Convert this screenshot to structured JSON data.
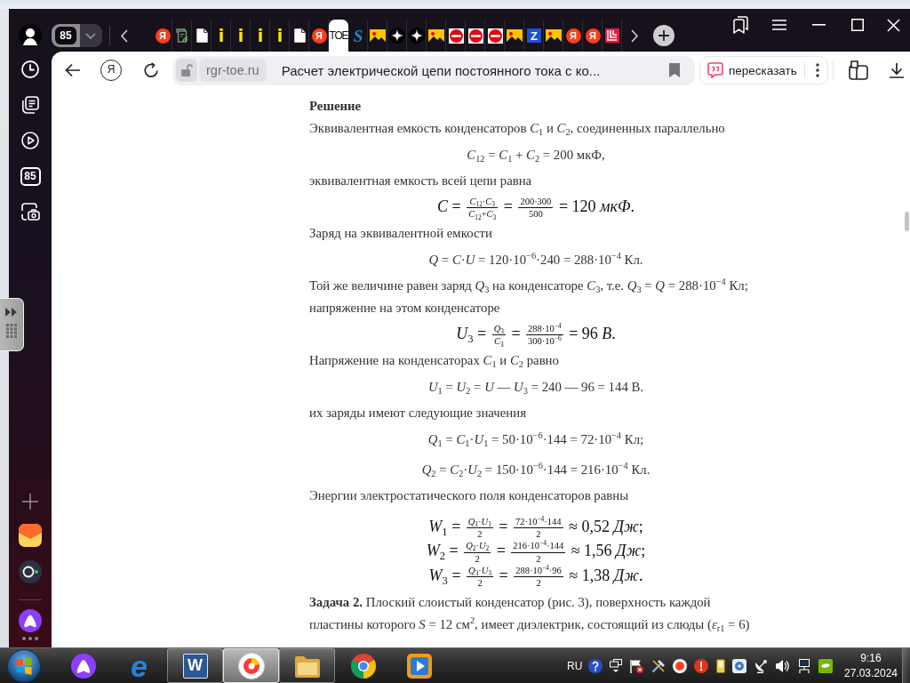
{
  "browser": {
    "tab_counter": "85",
    "tabs": [
      {
        "kind": "yandex",
        "glyph": "Я",
        "selected": false
      },
      {
        "kind": "sheet",
        "selected": false
      },
      {
        "kind": "page",
        "selected": false
      },
      {
        "kind": "info",
        "glyph": "i",
        "selected": false
      },
      {
        "kind": "info",
        "glyph": "i",
        "selected": false
      },
      {
        "kind": "info",
        "glyph": "i",
        "selected": false
      },
      {
        "kind": "info",
        "glyph": "i",
        "selected": false
      },
      {
        "kind": "page",
        "selected": false
      },
      {
        "kind": "yandex",
        "glyph": "Я",
        "selected": false
      },
      {
        "kind": "toe",
        "glyph": "TOE",
        "selected": true
      },
      {
        "kind": "letter",
        "glyph": "S",
        "selected": false
      },
      {
        "kind": "image",
        "selected": false
      },
      {
        "kind": "star",
        "selected": false
      },
      {
        "kind": "star",
        "selected": false
      },
      {
        "kind": "image",
        "selected": false
      },
      {
        "kind": "mon",
        "selected": false
      },
      {
        "kind": "mon",
        "selected": false
      },
      {
        "kind": "mon",
        "selected": false
      },
      {
        "kind": "image",
        "selected": false
      },
      {
        "kind": "square-letter",
        "glyph": "Z",
        "selected": false
      },
      {
        "kind": "image",
        "selected": false
      },
      {
        "kind": "yandex",
        "glyph": "Я",
        "selected": false
      },
      {
        "kind": "yandex",
        "glyph": "Я",
        "selected": false
      },
      {
        "kind": "stripes",
        "selected": false
      }
    ]
  },
  "address_bar": {
    "home_glyph": "Я",
    "domain": "rgr-toe.ru",
    "page_title": "Расчет электрической цепи постоянного тока с ко...",
    "retell_button": "пересказать"
  },
  "sidebar": {
    "counter": "85"
  },
  "article": {
    "blocks": [
      {
        "kind": "heading",
        "text": "Решение"
      },
      {
        "kind": "text",
        "text": "Эквивалентная емкость конденсаторов *C*$_{1}$ и *C*$_{2}$, соединенных параллельно"
      },
      {
        "kind": "formula",
        "text": "*C*$_{12}$ = *C*$_{1}$ + *C*$_{2}$ = 200 мкФ,"
      },
      {
        "kind": "text",
        "text": "эквивалентная емкость всей цепи равна"
      },
      {
        "kind": "display",
        "rows": [
          {
            "parts": [
              {
                "kind": "text",
                "text": "*C* = "
              },
              {
                "kind": "fraction",
                "numerator": "*C*$_{12}$·*C*$_{3}$",
                "denominator": "*C*$_{12}$+*C*$_{3}$"
              },
              {
                "kind": "text",
                "text": " = "
              },
              {
                "kind": "fraction",
                "numerator": "200·300",
                "denominator": "500"
              },
              {
                "kind": "text",
                "text": " = 120 *мкФ*."
              }
            ]
          }
        ]
      },
      {
        "kind": "text",
        "text": "Заряд на эквивалентной емкости"
      },
      {
        "kind": "formula",
        "text": "*Q* = *C*·*U* = 120·10$^{−6}$·240 = 288·10$^{−4}$ Кл."
      },
      {
        "kind": "text",
        "text": "Той же величине равен заряд *Q*$_{3}$ на конденсаторе *C*$_{3}$, т.е. *Q*$_{3}$ = *Q* = 288·10$^{−4}$ Кл;\nнапряжение на этом конденсаторе"
      },
      {
        "kind": "display",
        "rows": [
          {
            "parts": [
              {
                "kind": "text",
                "text": "*U*$_{3}$ = "
              },
              {
                "kind": "fraction",
                "numerator": "*Q*$_{3}$",
                "denominator": "*C*$_{3}$"
              },
              {
                "kind": "text",
                "text": " = "
              },
              {
                "kind": "fraction",
                "numerator": "288·10$^{−4}$",
                "denominator": "300·10$^{−6}$"
              },
              {
                "kind": "text",
                "text": " = 96 *В*."
              }
            ]
          }
        ]
      },
      {
        "kind": "text",
        "text": "Напряжение на конденсаторах *C*$_{1}$ и *C*$_{2}$ равно"
      },
      {
        "kind": "formula",
        "text": "*U*$_{1}$ = *U*$_{2}$ = *U* — *U*$_{3}$ = 240 — 96 = 144 В."
      },
      {
        "kind": "text",
        "text": "их заряды имеют следующие значения"
      },
      {
        "kind": "formula",
        "text": "*Q*$_{1}$ = *C*$_{1}$·*U*$_{1}$ = 50·10$^{−6}$·144 = 72·10$^{−4}$ Кл;"
      },
      {
        "kind": "formula",
        "text": "*Q*$_{2}$ = *C*$_{2}$·*U*$_{2}$ = 150·10$^{−6}$·144 = 216·10$^{−4}$ Кл."
      },
      {
        "kind": "text",
        "text": "Энергии электростатического поля конденсаторов равны"
      },
      {
        "kind": "display",
        "rows": [
          {
            "parts": [
              {
                "kind": "text",
                "text": "*W*$_{1}$ = "
              },
              {
                "kind": "fraction",
                "numerator": "*Q*$_{1}$·*U*$_{1}$",
                "denominator": "2"
              },
              {
                "kind": "text",
                "text": " = "
              },
              {
                "kind": "fraction",
                "numerator": "72·10$^{−4}$·144",
                "denominator": "2"
              },
              {
                "kind": "text",
                "text": " ≈ 0,52 *Дж*;"
              }
            ]
          },
          {
            "parts": [
              {
                "kind": "text",
                "text": "*W*$_{2}$ = "
              },
              {
                "kind": "fraction",
                "numerator": "*Q*$_{2}$·*U*$_{2}$",
                "denominator": "2"
              },
              {
                "kind": "text",
                "text": " = "
              },
              {
                "kind": "fraction",
                "numerator": "216·10$^{−4}$·144",
                "denominator": "2"
              },
              {
                "kind": "text",
                "text": " ≈ 1,56 *Дж*;"
              }
            ]
          },
          {
            "parts": [
              {
                "kind": "text",
                "text": "*W*$_{3}$ = "
              },
              {
                "kind": "fraction",
                "numerator": "*Q*$_{3}$·*U*$_{3}$",
                "denominator": "2"
              },
              {
                "kind": "text",
                "text": " = "
              },
              {
                "kind": "fraction",
                "numerator": "288·10$^{−4}$·96",
                "denominator": "2"
              },
              {
                "kind": "text",
                "text": " ≈ 1,38 *Дж*."
              }
            ]
          }
        ]
      },
      {
        "kind": "text",
        "text": "**Задача 2.** Плоский слоистый конденсатор (рис. 3), поверхность каждой\nпластины которого *S* = 12 см$^{2}$, имеет диэлектрик, состоящий из слюды (*ε*$_{r1}$ = 6)"
      }
    ]
  },
  "taskbar": {
    "apps": [
      {
        "kind": "alice",
        "running": false,
        "selected": false
      },
      {
        "kind": "ie",
        "glyph": "e",
        "running": false,
        "selected": false
      },
      {
        "kind": "word",
        "glyph": "W",
        "running": true,
        "selected": false
      },
      {
        "kind": "yandex-browser",
        "running": true,
        "selected": true
      },
      {
        "kind": "explorer",
        "running": true,
        "selected": false
      },
      {
        "kind": "chrome",
        "running": false,
        "selected": false
      },
      {
        "kind": "player",
        "running": false,
        "selected": false
      }
    ],
    "language": "RU",
    "time": "9:16",
    "date": "27.03.2024"
  }
}
